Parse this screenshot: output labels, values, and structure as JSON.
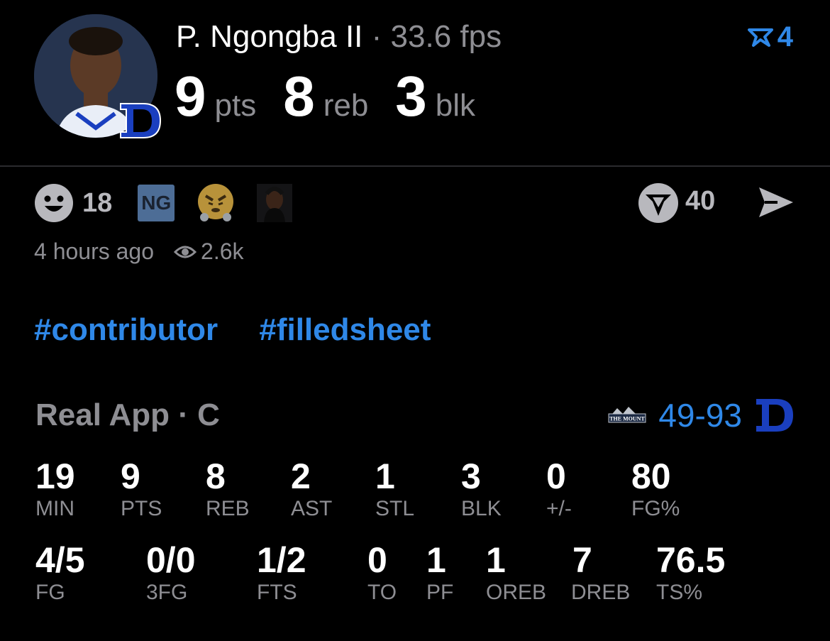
{
  "header": {
    "player_name": "P. Ngongba II",
    "separator": "·",
    "fps": "33.6 fps",
    "rank_count": "4",
    "headline": [
      {
        "value": "9",
        "label": "pts"
      },
      {
        "value": "8",
        "label": "reb"
      },
      {
        "value": "3",
        "label": "blk"
      }
    ]
  },
  "reactions": {
    "smile_count": "18",
    "ng_badge": "NG",
    "v_count": "40"
  },
  "meta": {
    "posted": "4 hours ago",
    "views": "2.6k"
  },
  "tags": [
    "#contributor",
    "#filledsheet"
  ],
  "game": {
    "label": "Real App · C",
    "opponent_logo_text": "THE MOUNT",
    "score": "49-93"
  },
  "stats_row1": [
    {
      "value": "19",
      "label": "MIN"
    },
    {
      "value": "9",
      "label": "PTS"
    },
    {
      "value": "8",
      "label": "REB"
    },
    {
      "value": "2",
      "label": "AST"
    },
    {
      "value": "1",
      "label": "STL"
    },
    {
      "value": "3",
      "label": "BLK"
    },
    {
      "value": "0",
      "label": "+/-"
    },
    {
      "value": "80",
      "label": "FG%"
    }
  ],
  "stats_row2": [
    {
      "value": "4/5",
      "label": "FG"
    },
    {
      "value": "0/0",
      "label": "3FG"
    },
    {
      "value": "1/2",
      "label": "FTS"
    },
    {
      "value": "0",
      "label": "TO"
    },
    {
      "value": "1",
      "label": "PF"
    },
    {
      "value": "1",
      "label": "OREB"
    },
    {
      "value": "7",
      "label": "DREB"
    },
    {
      "value": "76.5",
      "label": "TS%"
    }
  ],
  "colors": {
    "accent": "#2f88e8",
    "muted": "#8e8e93",
    "duke_blue": "#1a3fbf"
  }
}
